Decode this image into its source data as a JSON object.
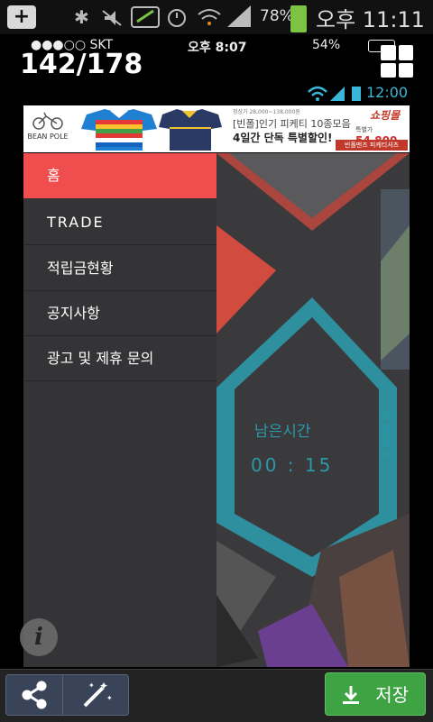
{
  "outer_status": {
    "battery": "78%",
    "time": "오후 11:11"
  },
  "counter": "142/178",
  "ios_status": {
    "carrier": "●●●○○ SKT",
    "time": "오후 8:07",
    "battery": "54%"
  },
  "inner_status": {
    "time": "12:00"
  },
  "ad": {
    "brand": "BEAN POLE",
    "small_text": "정상가 28,000~138,000원",
    "line1": "[빈폴]인기 피케티 10종모음",
    "line2": "4일간 단독 특별할인!",
    "logo": "쇼핑몰",
    "price": "54,800",
    "price_prefix": "특별가",
    "tag": "빈폴맨즈 피케티셔츠"
  },
  "menu": {
    "items": [
      {
        "label": "홈",
        "active": true
      },
      {
        "label": "TRADE",
        "active": false
      },
      {
        "label": "적립금현황",
        "active": false
      },
      {
        "label": "공지사항",
        "active": false
      },
      {
        "label": "광고 및 제휴 문의",
        "active": false
      }
    ]
  },
  "timer": {
    "label": "남은시간",
    "value": "00 : 15"
  },
  "guide": "이용안내",
  "toolbar": {
    "save_label": "저장"
  },
  "colors": {
    "accent_red": "#f04e4e",
    "teal": "#2a98a9",
    "save_green": "#3ea342"
  }
}
